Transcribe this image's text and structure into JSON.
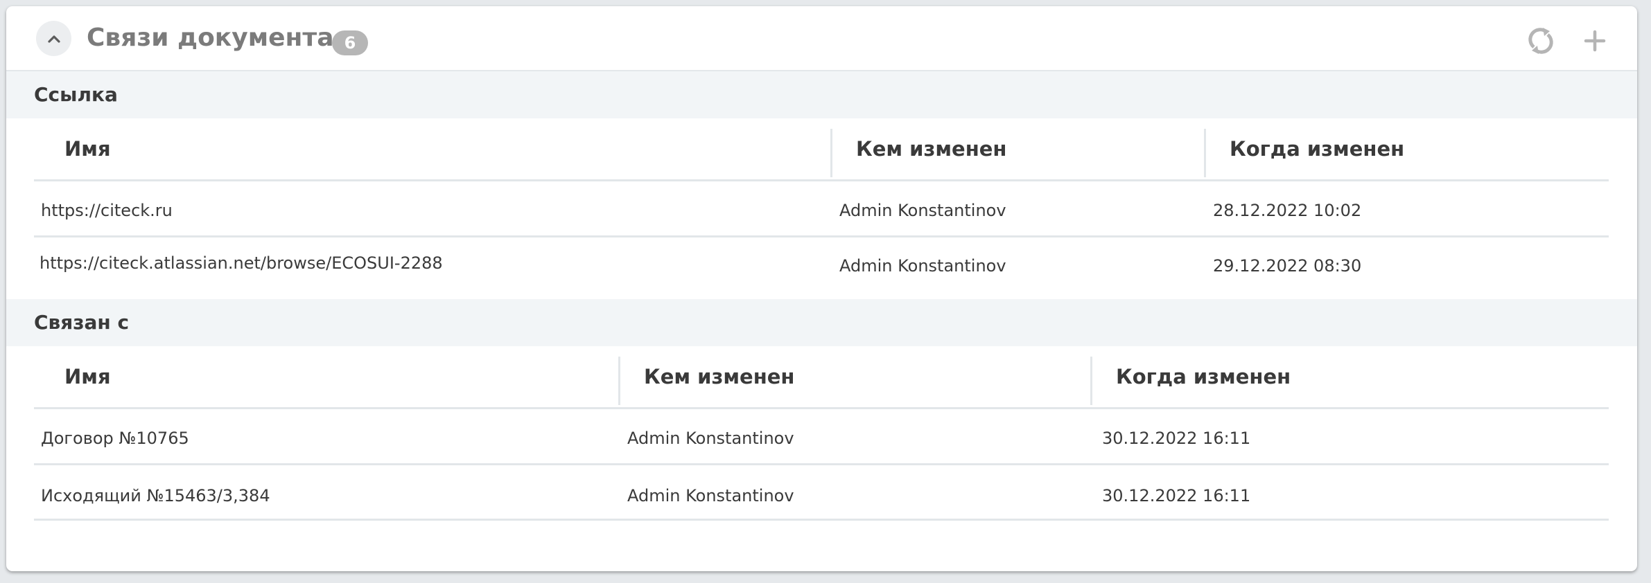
{
  "widget": {
    "title": "Связи документа",
    "count": "6"
  },
  "icons": {
    "collapse": "chevron-up-icon",
    "refresh": "refresh-icon",
    "add": "plus-icon"
  },
  "colors": {
    "title": "#7b7b7b",
    "badge_bg": "#b6b6b6",
    "section_bg": "#f2f5f7",
    "text": "#3a3a3a",
    "icon": "#b5b5b5"
  },
  "sections": [
    {
      "label": "Ссылка",
      "columns": [
        "Имя",
        "Кем изменен",
        "Когда изменен"
      ],
      "rows": [
        [
          "https://citeck.ru",
          "Admin Konstantinov",
          "28.12.2022 10:02"
        ],
        [
          "https://citeck.atlassian.net/browse/ECOSUI-2288",
          "Admin Konstantinov",
          "29.12.2022 08:30"
        ]
      ]
    },
    {
      "label": "Связан с",
      "columns": [
        "Имя",
        "Кем изменен",
        "Когда изменен"
      ],
      "rows": [
        [
          "Договор №10765",
          "Admin Konstantinov",
          "30.12.2022 16:11"
        ],
        [
          "Исходящий №15463/3,384",
          "Admin Konstantinov",
          "30.12.2022 16:11"
        ]
      ]
    }
  ]
}
